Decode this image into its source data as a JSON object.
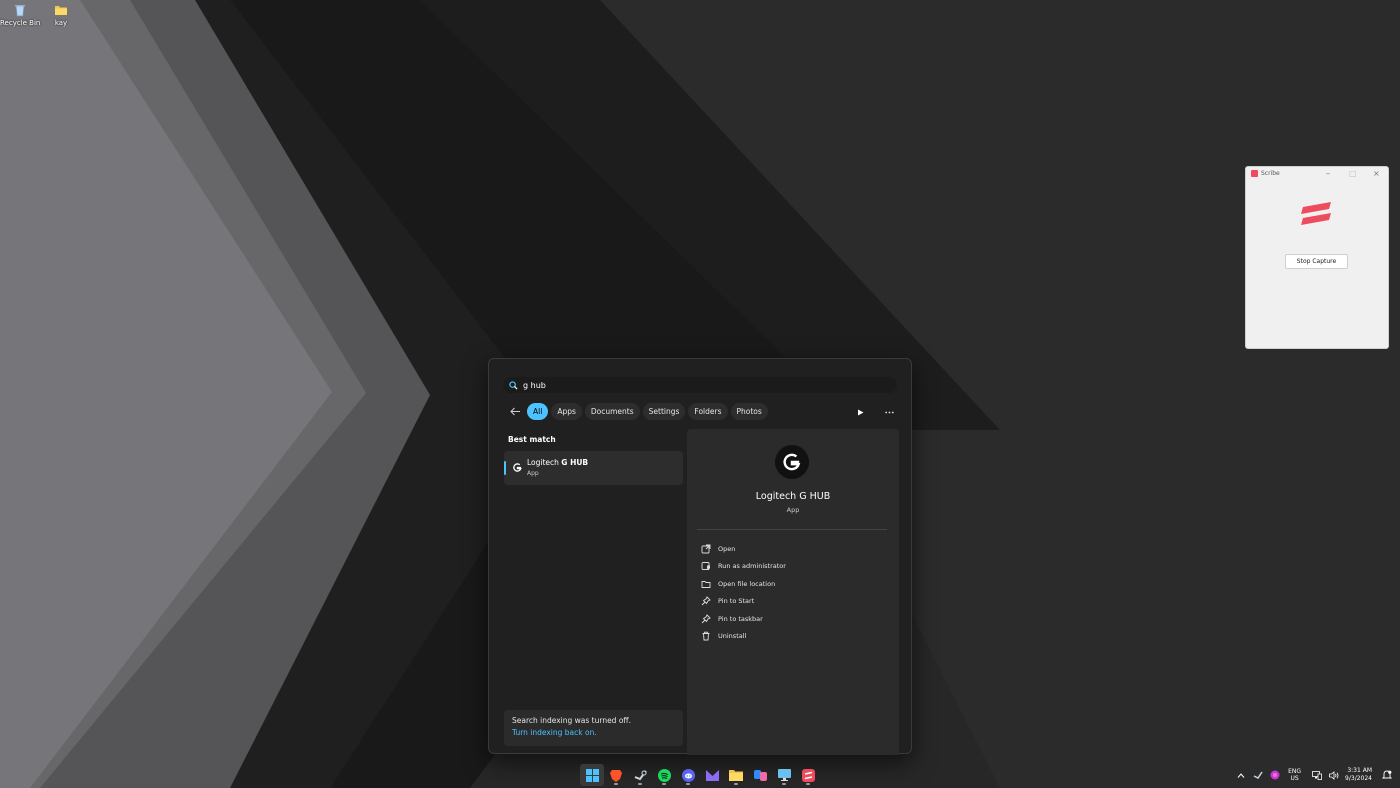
{
  "desktop": {
    "icons": [
      {
        "label": "Recycle Bin",
        "icon": "recycle-bin-icon"
      },
      {
        "label": "kay",
        "icon": "folder-icon"
      }
    ]
  },
  "search": {
    "query": "g hub",
    "filters": [
      "All",
      "Apps",
      "Documents",
      "Settings",
      "Folders",
      "Photos"
    ],
    "active_filter": "All",
    "best_match_heading": "Best match",
    "best_match": {
      "name_prefix": "Logitech ",
      "name_bold": "G HUB",
      "type": "App"
    },
    "index_notice": {
      "text": "Search indexing was turned off.",
      "link": "Turn indexing back on."
    },
    "detail": {
      "title": "Logitech G HUB",
      "type": "App",
      "actions": [
        {
          "label": "Open",
          "icon": "open-external-icon"
        },
        {
          "label": "Run as administrator",
          "icon": "shield-admin-icon"
        },
        {
          "label": "Open file location",
          "icon": "folder-icon"
        },
        {
          "label": "Pin to Start",
          "icon": "pin-icon"
        },
        {
          "label": "Pin to taskbar",
          "icon": "pin-icon"
        },
        {
          "label": "Uninstall",
          "icon": "trash-icon"
        }
      ]
    }
  },
  "scribe": {
    "title": "Scribe",
    "button": "Stop Capture",
    "accent": "#ee4b5d"
  },
  "taskbar": {
    "apps": [
      "start-icon",
      "brave-icon",
      "steam-icon",
      "spotify-icon",
      "discord-icon",
      "proton-mail-icon",
      "file-explorer-icon",
      "copilot-icon",
      "remote-desktop-icon",
      "scribe-icon"
    ],
    "tray": {
      "lang_line1": "ENG",
      "lang_line2": "US",
      "time": "3:31 AM",
      "date": "9/3/2024"
    }
  },
  "colors": {
    "accent": "#4cc2ff",
    "panel": "#202020",
    "detail": "#2b2b2b"
  }
}
